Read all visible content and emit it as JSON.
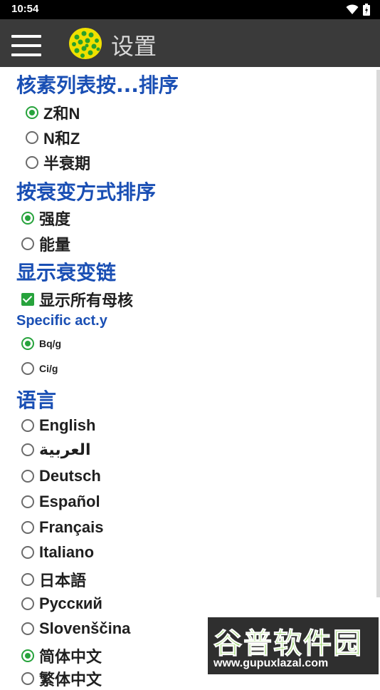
{
  "status_bar": {
    "time": "10:54"
  },
  "app_bar": {
    "title": "设置"
  },
  "sections": {
    "sort_nuclides": {
      "heading": "核素列表按...排序",
      "options": [
        {
          "label": "Z和N",
          "selected": true
        },
        {
          "label": "N和Z",
          "selected": false
        },
        {
          "label": "半衰期",
          "selected": false
        }
      ]
    },
    "sort_decay": {
      "heading": "按衰变方式排序",
      "options": [
        {
          "label": "强度",
          "selected": true
        },
        {
          "label": "能量",
          "selected": false
        }
      ]
    },
    "decay_chain": {
      "heading": "显示衰变链",
      "checkbox_label": "显示所有母核",
      "checked": true
    },
    "specific_activity": {
      "heading": "Specific act.y",
      "options": [
        {
          "label": "Bq/g",
          "selected": true
        },
        {
          "label": "Ci/g",
          "selected": false
        }
      ]
    },
    "language": {
      "heading": "语言",
      "options": [
        {
          "label": "English",
          "selected": false
        },
        {
          "label": "العربية",
          "selected": false
        },
        {
          "label": "Deutsch",
          "selected": false
        },
        {
          "label": "Español",
          "selected": false
        },
        {
          "label": "Français",
          "selected": false
        },
        {
          "label": "Italiano",
          "selected": false
        },
        {
          "label": "日本語",
          "selected": false
        },
        {
          "label": "Русский",
          "selected": false
        },
        {
          "label": "Slovenščina",
          "selected": false
        },
        {
          "label": "简体中文",
          "selected": true
        },
        {
          "label": "繁体中文",
          "selected": false
        }
      ]
    }
  },
  "watermark": {
    "text": "谷普软件园",
    "url": "www.gupuxlazal.com"
  },
  "colors": {
    "accent_green": "#27a33c",
    "heading_blue": "#1a4fb4",
    "app_bar": "#3a3a3a"
  }
}
